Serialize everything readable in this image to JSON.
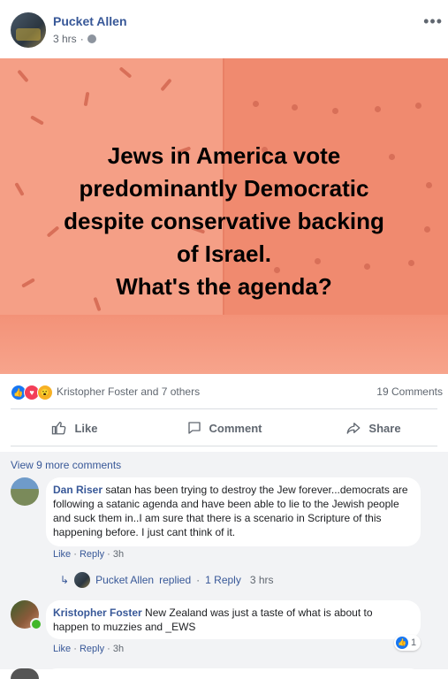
{
  "post": {
    "author": "Pucket Allen",
    "time": "3 hrs",
    "separator": "·",
    "privacy_icon": "globe-icon",
    "more_icon": "more-options-icon",
    "image_text": "Jews in America vote\npredominantly Democratic\ndespite conservative backing\nof Israel.\nWhat's the agenda?"
  },
  "reactions": {
    "icons": [
      "like-icon",
      "love-icon",
      "wow-icon"
    ],
    "summary": "Kristopher Foster and 7 others",
    "comments_count": "19 Comments"
  },
  "actions": {
    "like": "Like",
    "comment": "Comment",
    "share": "Share"
  },
  "comments_section": {
    "view_more": "View 9 more comments",
    "comments": [
      {
        "author": "Dan Riser",
        "text": "satan has been trying to destroy the Jew forever...democrats are following a satanic agenda and have been able to lie to the Jewish people and suck them in..I am sure that there is a scenario in Scripture of this happening before. I just cant think of it.",
        "like": "Like",
        "reply": "Reply",
        "time": "3h",
        "replies": {
          "author": "Pucket Allen",
          "label": "replied",
          "count": "1 Reply",
          "time": "3 hrs"
        }
      },
      {
        "author": "Kristopher Foster",
        "text": "New Zealand was just a taste of what is about to happen to muzzies and _EWS",
        "like": "Like",
        "reply": "Reply",
        "time": "3h",
        "like_count": "1"
      }
    ]
  },
  "colors": {
    "link": "#385898",
    "muted": "#606770",
    "image_bg": "#f4977e",
    "comment_bg": "#f2f3f5"
  }
}
